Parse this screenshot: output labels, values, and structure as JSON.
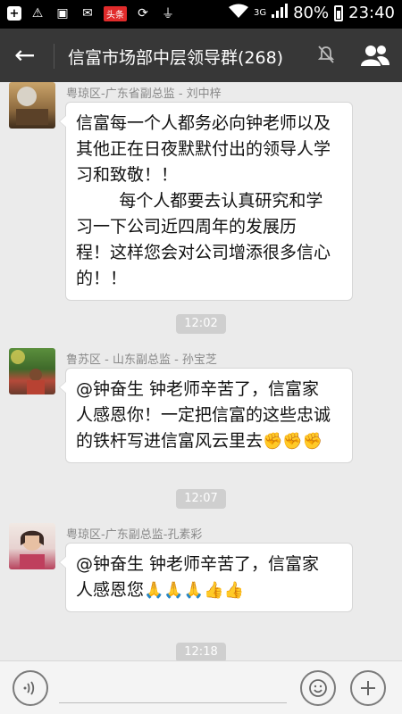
{
  "status_bar": {
    "battery": "80%",
    "time": "23:40",
    "network": "3G",
    "news_badge": "头条",
    "icons": [
      "add-icon",
      "warning-icon",
      "image-icon",
      "mail-icon",
      "news-app-icon",
      "sync-icon",
      "usb-icon",
      "wifi-icon",
      "signal-icon",
      "battery-icon"
    ]
  },
  "header": {
    "back_icon": "back-arrow-icon",
    "title": "信富市场部中层领导群(268)",
    "mute_icon": "mute-icon",
    "group_icon": "group-members-icon"
  },
  "messages": [
    {
      "sender": "粤琼区-广东省副总监 - 刘中梓",
      "lines": [
        "信富每一个人都务必向钟老师以及",
        "其他正在日夜默默付出的领导人学",
        "习和致敬！！",
        "        每个人都要去认真研究和学",
        "习一下公司近四周年的发展历",
        "程！这样您会对公司增添很多信心",
        "的！！"
      ],
      "avatar": "avatar-room"
    },
    {
      "time": "12:02",
      "sender": "鲁苏区 - 山东副总监 - 孙宝芝",
      "lines": [
        "@钟奋生 钟老师辛苦了，信富家",
        "人感恩你！一定把信富的这些忠诚",
        "的铁杆写进信富风云里去"
      ],
      "emoji": "✊✊✊",
      "avatar": "avatar-garden"
    },
    {
      "time": "12:07",
      "sender": "粤琼区-广东副总监-孔素彩",
      "lines": [
        "@钟奋生 钟老师辛苦了，信富家",
        "人感恩您"
      ],
      "emoji": "🙏🙏🙏👍👍",
      "avatar": "avatar-portrait"
    },
    {
      "time": "12:18"
    }
  ],
  "input_bar": {
    "voice_icon": "voice-icon",
    "emoji_icon": "emoji-icon",
    "plus_icon": "plus-icon"
  },
  "colors": {
    "status_bar_bg": "#000000",
    "title_bar_bg": "#373737",
    "chat_bg": "#ebebeb",
    "bubble_bg": "#ffffff",
    "time_chip_bg": "#cfcfcf"
  }
}
